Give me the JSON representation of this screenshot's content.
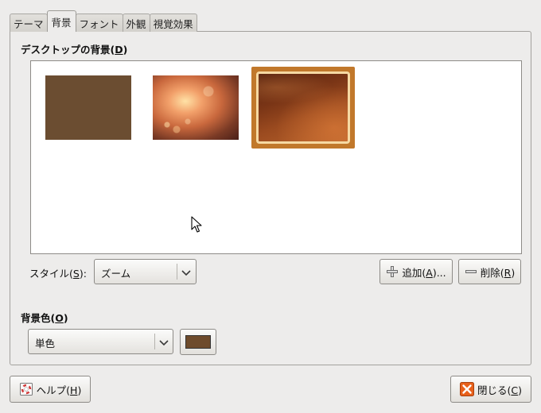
{
  "tabs": [
    {
      "label": "テーマ",
      "active": false
    },
    {
      "label": "背景",
      "active": true
    },
    {
      "label": "フォント",
      "active": false
    },
    {
      "label": "外観",
      "active": false
    },
    {
      "label": "視覚効果",
      "active": false
    }
  ],
  "background": {
    "heading_text": "デスクトップの背景(",
    "heading_mnemonic": "D",
    "heading_close": ")",
    "wallpapers": [
      {
        "name": "solid-brown",
        "selected": false
      },
      {
        "name": "warm-bokeh",
        "selected": false
      },
      {
        "name": "ubuntu-default",
        "selected": true
      }
    ],
    "style_label_text": "スタイル(",
    "style_label_mnemonic": "S",
    "style_label_close": "):",
    "style_value": "ズーム",
    "add_text": "追加(",
    "add_mnemonic": "A",
    "add_close": ")...",
    "remove_text": "削除(",
    "remove_mnemonic": "R",
    "remove_close": ")"
  },
  "color": {
    "heading_text": "背景色(",
    "heading_mnemonic": "O",
    "heading_close": ")",
    "mode_value": "単色",
    "swatch": "#6e4b2c"
  },
  "footer": {
    "help_text": "ヘルプ(",
    "help_mnemonic": "H",
    "help_close": ")",
    "close_text": "閉じる(",
    "close_mnemonic": "C",
    "close_close": ")"
  },
  "colors": {
    "selection": "#c1782b",
    "close_icon": "#e8601a"
  }
}
